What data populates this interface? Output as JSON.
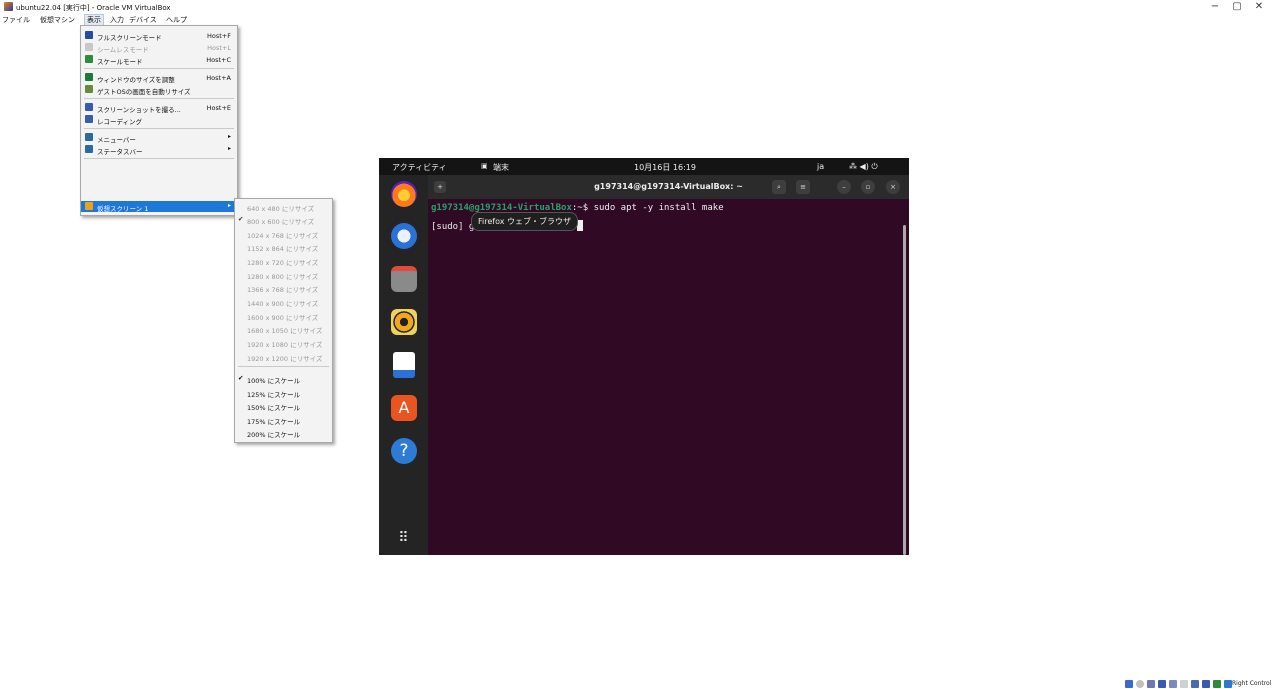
{
  "window": {
    "title": "ubuntu22.04 [実行中] - Oracle VM VirtualBox",
    "minimize": "−",
    "maximize": "▢",
    "close": "✕"
  },
  "menubar": {
    "items": [
      "ファイル",
      "仮想マシン",
      "表示",
      "入力",
      "デバイス",
      "ヘルプ"
    ]
  },
  "view_menu": {
    "items": [
      {
        "label": "フルスクリーンモード",
        "shortcut": "Host+F"
      },
      {
        "label": "シームレスモード",
        "shortcut": "Host+L"
      },
      {
        "label": "スケールモード",
        "shortcut": "Host+C"
      },
      {
        "label": "ウィンドウのサイズを調整",
        "shortcut": "Host+A"
      },
      {
        "label": "ゲストOSの画面を自動リサイズ",
        "shortcut": ""
      },
      {
        "label": "スクリーンショットを撮る...",
        "shortcut": "Host+E"
      },
      {
        "label": "レコーディング",
        "shortcut": ""
      },
      {
        "label": "メニューバー",
        "shortcut": ""
      },
      {
        "label": "ステータスバー",
        "shortcut": ""
      },
      {
        "label": "仮想スクリーン 1",
        "shortcut": ""
      }
    ]
  },
  "submenu": {
    "resize": [
      "640 x 480 にリサイズ",
      "800 x 600 にリサイズ",
      "1024 x 768 にリサイズ",
      "1152 x 864 にリサイズ",
      "1280 x 720 にリサイズ",
      "1280 x 800 にリサイズ",
      "1366 x 768 にリサイズ",
      "1440 x 900 にリサイズ",
      "1600 x 900 にリサイズ",
      "1680 x 1050 にリサイズ",
      "1920 x 1080 にリサイズ",
      "1920 x 1200 にリサイズ"
    ],
    "scale": [
      "100% にスケール",
      "125% にスケール",
      "150% にスケール",
      "175% にスケール",
      "200% にスケール"
    ],
    "check": "✔"
  },
  "ubuntu": {
    "activities": "アクティビティ",
    "terminal_app": "端末",
    "clock": "10月16日 16:19",
    "lang": "ja",
    "tray": "⁂ ◀) ⏻"
  },
  "tooltip": "Firefox ウェブ・ブラウザ",
  "terminal": {
    "title": "g197314@g197314-VirtualBox: ~",
    "line1_prompt": "g197314@g197314-VirtualBox",
    "line1_rest": ":~$ sudo apt -y install make",
    "line2": "[sudo] g197314 のパスワード: "
  },
  "statusbar": {
    "host_key": "Right Control"
  }
}
